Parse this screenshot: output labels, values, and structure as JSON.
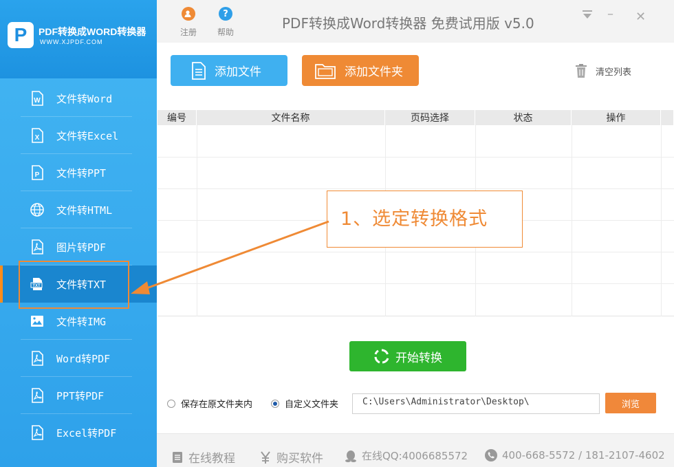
{
  "sidebar": {
    "logo_letter": "P",
    "logo_title": "PDF转换成WORD转换器",
    "logo_url": "WWW.XJPDF.COM",
    "items": [
      {
        "label": "文件转Word",
        "icon": "word-doc-icon"
      },
      {
        "label": "文件转Excel",
        "icon": "excel-doc-icon"
      },
      {
        "label": "文件转PPT",
        "icon": "ppt-doc-icon"
      },
      {
        "label": "文件转HTML",
        "icon": "globe-icon"
      },
      {
        "label": "图片转PDF",
        "icon": "pdf-doc-icon"
      },
      {
        "label": "文件转TXT",
        "icon": "txt-file-icon"
      },
      {
        "label": "文件转IMG",
        "icon": "image-icon"
      },
      {
        "label": "Word转PDF",
        "icon": "pdf-doc-icon"
      },
      {
        "label": "PPT转PDF",
        "icon": "pdf-doc-icon"
      },
      {
        "label": "Excel转PDF",
        "icon": "pdf-doc-icon"
      }
    ],
    "active_index": 5
  },
  "titlebar": {
    "register_label": "注册",
    "help_label": "帮助",
    "help_glyph": "?",
    "app_title": "PDF转换成Word转换器 免费试用版 v5.0",
    "min_glyph": "–",
    "close_glyph": "✕"
  },
  "toolbar": {
    "add_file_label": "添加文件",
    "add_folder_label": "添加文件夹",
    "clear_label": "清空列表"
  },
  "table": {
    "columns": [
      "编号",
      "文件名称",
      "页码选择",
      "状态",
      "操作"
    ]
  },
  "annotation": {
    "text": "1、选定转换格式"
  },
  "start_label": "开始转换",
  "save": {
    "option_original": "保存在原文件夹内",
    "option_custom": "自定义文件夹",
    "selected": "custom",
    "path_value": "C:\\Users\\Administrator\\Desktop\\",
    "browse_label": "浏览"
  },
  "footer": {
    "tutorial_label": "在线教程",
    "buy_label": "购买软件",
    "qq_label": "在线QQ:4006685572",
    "phone_label": "400-668-5572 / 181-2107-4602"
  },
  "colors": {
    "sidebar_blue": "#3aaaf0",
    "accent_orange": "#ef8a35",
    "start_green": "#2eb52e",
    "button_blue": "#3fb0f0"
  }
}
